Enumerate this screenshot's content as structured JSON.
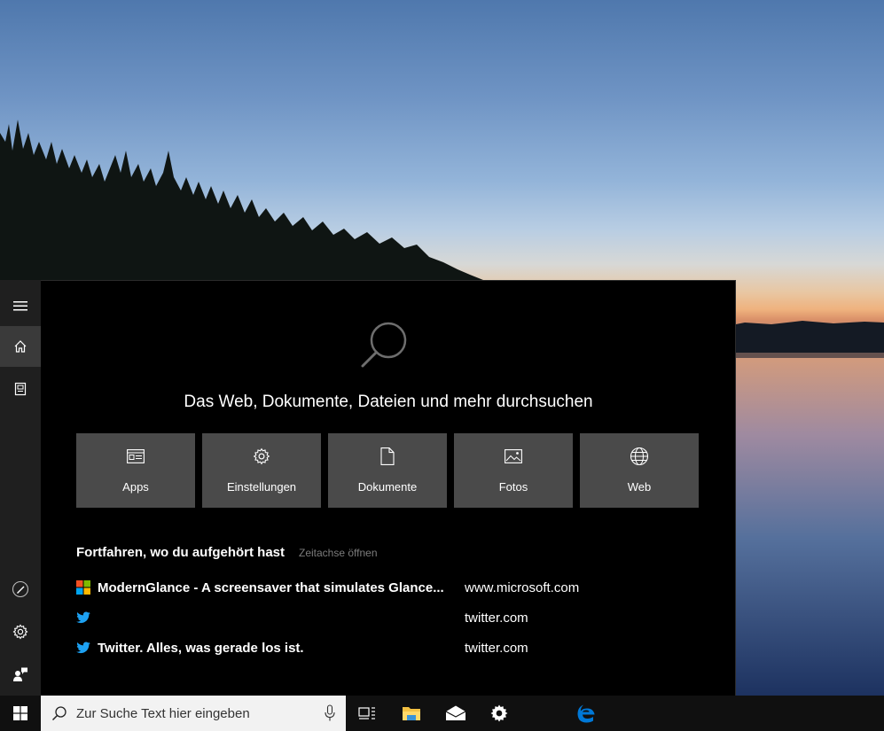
{
  "search_panel": {
    "hero_text": "Das Web, Dokumente, Dateien und mehr durchsuchen",
    "tiles": [
      {
        "label": "Apps",
        "icon": "apps-icon"
      },
      {
        "label": "Einstellungen",
        "icon": "gear-icon"
      },
      {
        "label": "Dokumente",
        "icon": "document-icon"
      },
      {
        "label": "Fotos",
        "icon": "photo-icon"
      },
      {
        "label": "Web",
        "icon": "globe-icon"
      }
    ],
    "recent": {
      "title": "Fortfahren, wo du aufgehört hast",
      "timeline_link": "Zeitachse öffnen",
      "items": [
        {
          "title": "ModernGlance - A screensaver that simulates Glance...",
          "url": "www.microsoft.com",
          "icon": "microsoft-logo-icon"
        },
        {
          "title": "",
          "url": "twitter.com",
          "icon": "twitter-bird-icon"
        },
        {
          "title": "Twitter. Alles, was gerade los ist.",
          "url": "twitter.com",
          "icon": "twitter-bird-icon"
        }
      ]
    }
  },
  "sidebar": {
    "items": [
      {
        "name": "menu",
        "icon": "hamburger-icon"
      },
      {
        "name": "home",
        "icon": "home-icon"
      },
      {
        "name": "notebook",
        "icon": "notebook-icon"
      },
      {
        "name": "pen",
        "icon": "pen-icon"
      },
      {
        "name": "settings",
        "icon": "gear-icon"
      },
      {
        "name": "feedback",
        "icon": "feedback-icon"
      }
    ]
  },
  "taskbar": {
    "search_placeholder": "Zur Suche Text hier eingeben",
    "pinned": [
      "task-view-icon",
      "file-explorer-icon",
      "mail-icon",
      "settings-icon",
      "edge-icon"
    ]
  },
  "colors": {
    "panel_bg": "#000000",
    "sidebar_bg": "#1f1f1f",
    "tile_bg": "#4a4a4a",
    "taskbar_bg": "#101010",
    "twitter_blue": "#1da1f2",
    "edge_blue": "#0078d7"
  }
}
